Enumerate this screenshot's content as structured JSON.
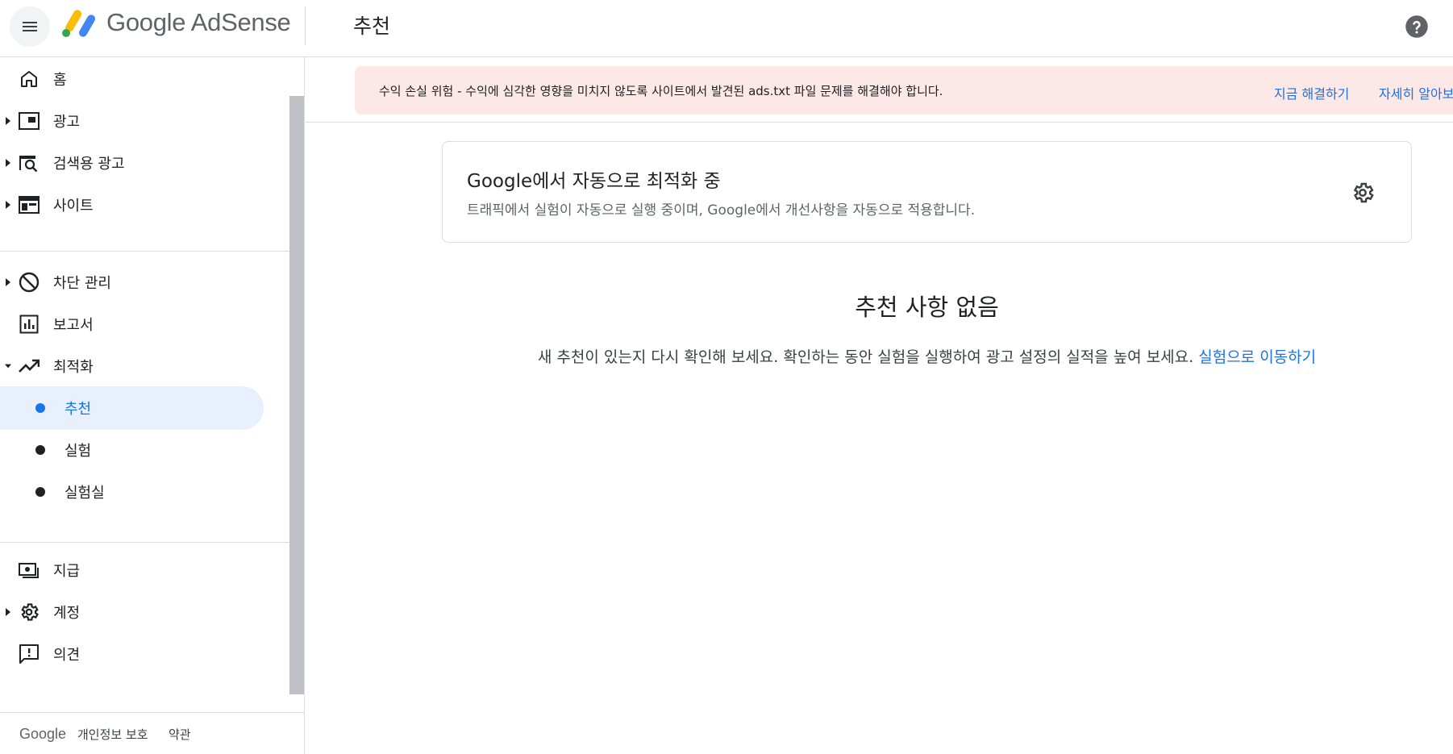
{
  "header": {
    "menu_icon": "hamburger-menu-icon",
    "brand": "Google AdSense",
    "page_title": "추천",
    "help_icon": "help-circle-icon"
  },
  "sidebar": {
    "items": [
      {
        "label": "홈",
        "icon": "home-icon"
      },
      {
        "label": "광고",
        "icon": "ads-icon"
      },
      {
        "label": "검색용 광고",
        "icon": "search-ads-icon"
      },
      {
        "label": "사이트",
        "icon": "sites-icon"
      },
      {
        "label": "차단 관리",
        "icon": "block-icon"
      },
      {
        "label": "보고서",
        "icon": "reports-icon"
      },
      {
        "label": "최적화",
        "icon": "trending-up-icon"
      },
      {
        "label": "지급",
        "icon": "payments-icon"
      },
      {
        "label": "계정",
        "icon": "gear-icon"
      },
      {
        "label": "의견",
        "icon": "feedback-icon"
      }
    ],
    "optimization_sub": [
      {
        "label": "추천",
        "active": true
      },
      {
        "label": "실험",
        "active": false
      },
      {
        "label": "실험실",
        "active": false
      }
    ],
    "footer": {
      "google": "Google",
      "privacy": "개인정보 보호",
      "terms": "약관"
    }
  },
  "banner": {
    "text": "수익 손실 위험 - 수익에 심각한 영향을 미치지 않도록 사이트에서 발견된 ads.txt 파일 문제를 해결해야 합니다.",
    "fix_now": "지금 해결하기",
    "learn_more": "자세히 알아보"
  },
  "card": {
    "title": "Google에서 자동으로 최적화 중",
    "description": "트래픽에서 실험이 자동으로 실행 중이며, Google에서 개선사항을 자동으로 적용합니다.",
    "settings_icon": "gear-icon"
  },
  "empty_state": {
    "title": "추천 사항 없음",
    "description": "새 추천이 있는지 다시 확인해 보세요. 확인하는 동안 실험을 실행하여 광고 설정의 실적을 높여 보세요.",
    "link": "실험으로 이동하기"
  },
  "colors": {
    "accent": "#1a73e8",
    "banner_bg": "#fce8e6",
    "active_nav_bg": "#e8f0fe",
    "logo_yellow": "#fbbc04",
    "logo_green": "#34a853",
    "logo_blue": "#4285f4"
  }
}
